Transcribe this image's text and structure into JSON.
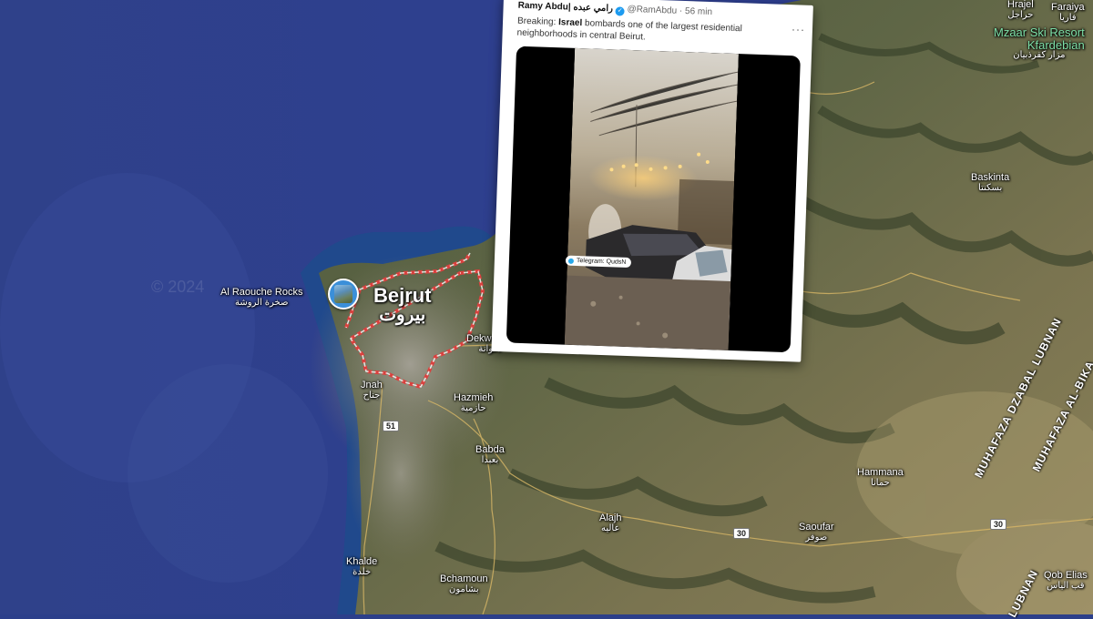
{
  "map": {
    "watermark": "© 2024",
    "road_shields": [
      "51",
      "30",
      "30"
    ],
    "places": {
      "beirut": {
        "name": "Bejrut",
        "arabic": "بيروت"
      },
      "raouche": {
        "name": "Al Raouche Rocks",
        "arabic": "صخرة الروشة"
      },
      "dekwaneh": {
        "name": "Dekwaneh",
        "arabic": "دكوانة"
      },
      "jnah": {
        "name": "Jnah",
        "arabic": "جناح"
      },
      "hazmieh": {
        "name": "Hazmieh",
        "arabic": "حازمية"
      },
      "babda": {
        "name": "Babda",
        "arabic": "بعبدا"
      },
      "aley": {
        "name": "Alajh",
        "arabic": "عاليه"
      },
      "khalde": {
        "name": "Khalde",
        "arabic": "خلدة"
      },
      "bchamoun": {
        "name": "Bchamoun",
        "arabic": "بشامون"
      },
      "hammana": {
        "name": "Hammana",
        "arabic": "حمانا"
      },
      "saoufar": {
        "name": "Saoufar",
        "arabic": "صوفر"
      },
      "baskinta": {
        "name": "Baskinta",
        "arabic": "بسكنتا"
      },
      "qob_elias": {
        "name": "Qob Elias",
        "arabic": "قب الياس"
      },
      "hrajel": {
        "name": "Hrajel",
        "arabic": "حراجل"
      },
      "faraiya": {
        "name": "Faraiya",
        "arabic": "فاريا"
      },
      "mzaar": {
        "name": "Mzaar Ski Resort Kfardebian",
        "line1": "Mzaar Ski Resort",
        "line2": "Kfardebian",
        "arabic": "مزار كفرذبيان"
      }
    },
    "regions": [
      "MUHAFAZA DZABAL LUBNAN",
      "MUHAFAZA AL-BIKA",
      "LUBNAN"
    ]
  },
  "tweet": {
    "display_name": "Ramy Abdu|",
    "arabic_name": "رامي عبده",
    "handle": "@RamAbdu",
    "time": "· 56 min",
    "more": "···",
    "text_prefix": "Breaking: ",
    "text_bold": "Israel",
    "text_rest": " bombards one of the largest residential neighborhoods in central Beirut.",
    "video_label": "Telegram: QudsN"
  }
}
